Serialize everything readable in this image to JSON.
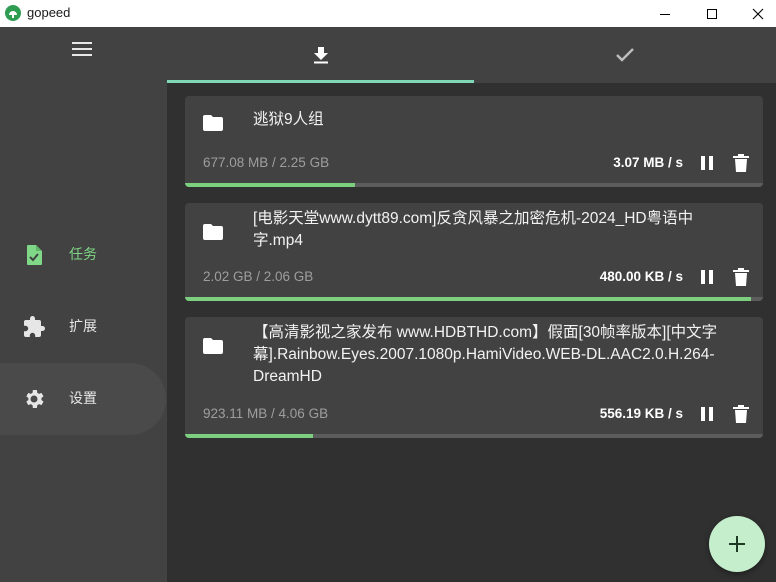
{
  "window": {
    "title": "gopeed"
  },
  "sidebar": {
    "items": [
      {
        "label": "任务",
        "icon": "task-icon",
        "active": true
      },
      {
        "label": "扩展",
        "icon": "puzzle-icon",
        "active": false
      },
      {
        "label": "设置",
        "icon": "gear-icon",
        "active": false
      }
    ]
  },
  "tabs": [
    {
      "icon": "download-icon",
      "selected": true
    },
    {
      "icon": "check-icon",
      "selected": false
    }
  ],
  "tasks": [
    {
      "name": "逃狱9人组",
      "size": "677.08 MB / 2.25 GB",
      "speed": "3.07 MB / s",
      "progress": 0.294
    },
    {
      "name": "[电影天堂www.dytt89.com]反贪风暴之加密危机-2024_HD粤语中字.mp4",
      "size": "2.02 GB / 2.06 GB",
      "speed": "480.00 KB / s",
      "progress": 0.98
    },
    {
      "name": "【高清影视之家发布 www.HDBTHD.com】假面[30帧率版本][中文字幕].Rainbow.Eyes.2007.1080p.HamiVideo.WEB-DL.AAC2.0.H.264-DreamHD",
      "size": "923.11 MB / 4.06 GB",
      "speed": "556.19 KB / s",
      "progress": 0.222
    }
  ],
  "colors": {
    "accent": "#7fd787",
    "progress": "#7ccf7f",
    "fab": "#c5efcc",
    "sidebar": "#424242",
    "background": "#303030"
  }
}
